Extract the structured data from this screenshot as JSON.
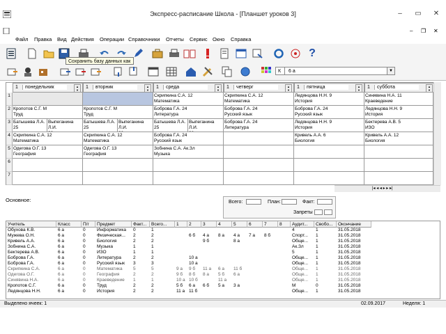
{
  "window": {
    "title": "Экспресс-расписание Школа - [Планшет уроков 3]"
  },
  "menu": [
    "Файл",
    "Правка",
    "Вид",
    "Действия",
    "Операции",
    "Справочники",
    "Отчеты",
    "Сервис",
    "Окно",
    "Справка"
  ],
  "tooltip": "Сохранить базу данных как",
  "class_combo": {
    "prefix": "К",
    "value": "6 а"
  },
  "days": [
    {
      "num": "1",
      "name": "понедельник"
    },
    {
      "num": "1",
      "name": "вторник"
    },
    {
      "num": "1",
      "name": "среда"
    },
    {
      "num": "1",
      "name": "четверг"
    },
    {
      "num": "1",
      "name": "пятница"
    },
    {
      "num": "1",
      "name": "суббота"
    }
  ],
  "row_numbers": [
    "1",
    "2",
    "3",
    "4",
    "5",
    "6",
    "7"
  ],
  "schedule": [
    [
      "",
      "",
      "Скрипкина С.А.   12|Математика",
      "Скрипкина С.А.   12|Математика",
      "Ледянцова Н.Н.   9|История",
      "Синявина Н.А.   11|Краеведение"
    ],
    [
      "Кропотов С.Г.   М|Труд",
      "Кропотов С.Г.   М|Труд",
      "Боброва Г.А.   24|Литература",
      "Боброва Г.А.   24|Русский язык",
      "Боброва Г.А.   24|Русский язык",
      "Ледянцова Н.Н.   9|История"
    ],
    [
      "SPLIT:Батышева Л.А.|25|Выпеганина Л.И.|23",
      "SPLIT:Батышева Л.А.|25|Выпеганина Л.И.|23",
      "SPLIT:Батышева Л.А.|25|Выпеганина Л.И.|23",
      "Боброва Г.А.   24|Литература",
      "Ледянцова Н.Н.   9|История",
      "Бектерева А.В.   5|ИЗО"
    ],
    [
      "Скрипкина С.А.   12|Математика",
      "Скрипкина С.А.   12|Математика",
      "Боброва Г.А.   24|Русский язык",
      "",
      "Кривель А.А.   6|Биология",
      "Кривель А.А.   12|Биология"
    ],
    [
      "Одегова О.Г.   13|География",
      "Одегова О.Г.   13|География",
      "Зобнина С.А.   Ак.Зл|Музыка",
      "",
      "",
      ""
    ],
    [
      "",
      "",
      "",
      "",
      "",
      ""
    ],
    [
      "",
      "",
      "",
      "",
      "",
      ""
    ]
  ],
  "lower_label": "Основное:",
  "stats": {
    "total": "Всего:",
    "plan": "План:",
    "fact": "Факт:",
    "bans": "Запреты"
  },
  "lower_headers": [
    "Учитель",
    "Класс",
    "П/г",
    "Предмет",
    "Факт...",
    "Всего...",
    "1",
    "2",
    "3",
    "4",
    "5",
    "6",
    "7",
    "8",
    "Аудит...",
    "Свобо...",
    "Окончание"
  ],
  "lower_rows": [
    [
      "Обухова К.В.",
      "6 а",
      "0",
      "Информатика",
      "0",
      "1",
      "",
      "",
      "",
      "",
      "",
      "",
      "",
      "",
      "4",
      "1",
      "31.05.2018"
    ],
    [
      "Мужева О.Н.",
      "6 а",
      "0",
      "Физическая...",
      "2",
      "2",
      "",
      "6 б",
      "4 а",
      "8 а",
      "4 а",
      "7 а",
      "8 б",
      "",
      "Спорт...",
      "1",
      "31.05.2018"
    ],
    [
      "Кривель А.А.",
      "6 а",
      "0",
      "Биология",
      "2",
      "2",
      "",
      "",
      "9 б",
      "",
      "8 а",
      "",
      "",
      "",
      "Обще...",
      "1",
      "31.05.2018"
    ],
    [
      "Зобнина С.А.",
      "6 а",
      "0",
      "Музыка",
      "1",
      "1",
      "",
      "",
      "",
      "",
      "",
      "",
      "",
      "",
      "Ак.Зл",
      "1",
      "31.05.2018"
    ],
    [
      "Бектерева А.В.",
      "6 а",
      "0",
      "ИЗО",
      "1",
      "1",
      "",
      "",
      "",
      "",
      "",
      "",
      "",
      "",
      "5",
      "1",
      "31.05.2018"
    ],
    [
      "Боброва Г.А.",
      "6 а",
      "0",
      "Литература",
      "2",
      "2",
      "",
      "10 а",
      "",
      "",
      "",
      "",
      "",
      "",
      "Обще...",
      "1",
      "31.05.2018"
    ],
    [
      "Боброва Г.А.",
      "6 а",
      "0",
      "Русский язык",
      "3",
      "3",
      "",
      "10 а",
      "",
      "",
      "",
      "",
      "",
      "",
      "Обще...",
      "1",
      "31.05.2018"
    ],
    [
      "Скрипкина С.А.",
      "6 а",
      "0",
      "Математика",
      "5",
      "5",
      "9 а",
      "9 б",
      "11 а",
      "6 а",
      "11 б",
      "",
      "",
      "",
      "Обще...",
      "1",
      "31.05.2018"
    ],
    [
      "Одегова О.Г.",
      "6 а",
      "0",
      "География",
      "2",
      "2",
      "9 б",
      "8 б",
      "8 а",
      "5 б",
      "6 а",
      "",
      "",
      "",
      "Обще...",
      "1",
      "31.05.2018"
    ],
    [
      "Синявина Н.А.",
      "6 а",
      "0",
      "Краеведение",
      "1",
      "1",
      "10 а",
      "10 б",
      "",
      "11 а",
      "",
      "",
      "",
      "",
      "Обще...",
      "1",
      "31.05.2018"
    ],
    [
      "Кропотов С.Г.",
      "6 а",
      "0",
      "Труд",
      "2",
      "2",
      "5 б",
      "6 а",
      "6 б",
      "5 а",
      "3 а",
      "",
      "",
      "",
      "М",
      "0",
      "31.05.2018"
    ],
    [
      "Ледянцова Н.Н.",
      "6 а",
      "0",
      "История",
      "2",
      "2",
      "11 а",
      "11 б",
      "",
      "",
      "",
      "",
      "",
      "",
      "Обще...",
      "1",
      "31.05.2018"
    ]
  ],
  "status": {
    "selected": "Выделено ячеек: 1",
    "date": "02.09.2017",
    "week": "Неделя: 1"
  }
}
